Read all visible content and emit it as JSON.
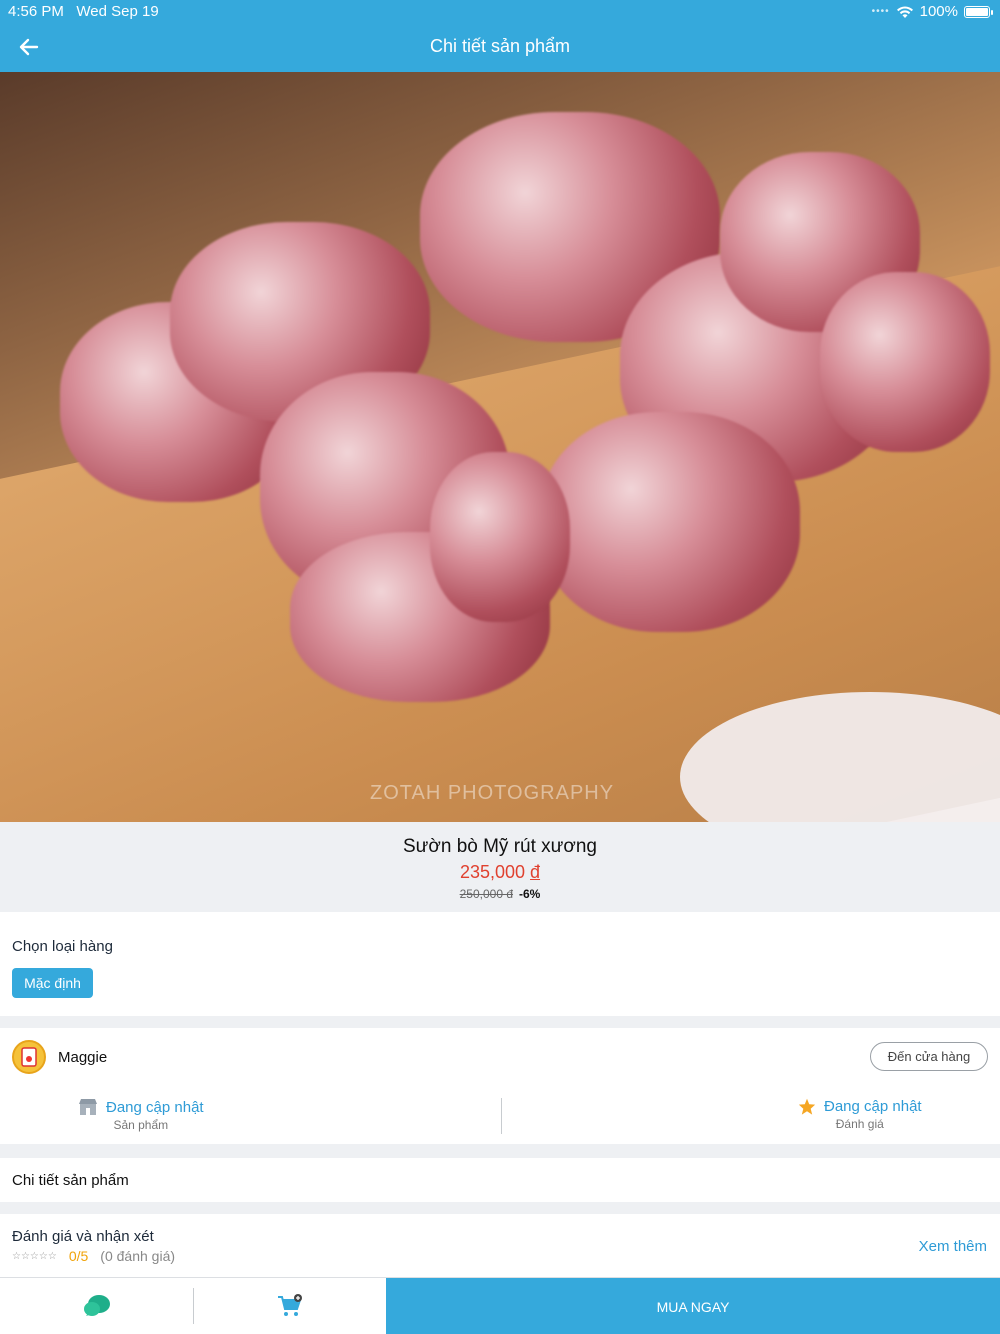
{
  "status_bar": {
    "time": "4:56 PM",
    "date": "Wed Sep 19",
    "battery": "100%"
  },
  "header": {
    "title": "Chi tiết sản phẩm",
    "back_icon": "arrow-left-icon"
  },
  "hero": {
    "watermark": "ZOTAH PHOTOGRAPHY"
  },
  "product": {
    "name": "Sườn bò Mỹ rút xương",
    "price": "235,000",
    "currency": "đ",
    "old_price": "250,000 đ",
    "discount": "-6%"
  },
  "variant": {
    "label": "Chọn loại hàng",
    "selected": "Mặc định"
  },
  "shop": {
    "name": "Maggie",
    "store_button": "Đến cửa hàng",
    "products_value": "Đang cập nhật",
    "products_caption": "Sản phẩm",
    "rating_value": "Đang cập nhật",
    "rating_caption": "Đánh giá"
  },
  "detail": {
    "label": "Chi tiết sản phẩm"
  },
  "review": {
    "label": "Đánh giá và nhận xét",
    "score": "0/5",
    "count": "(0 đánh giá)",
    "more": "Xem thêm"
  },
  "bottom": {
    "buy_label": "MUA NGAY"
  },
  "colors": {
    "primary": "#35a9dc",
    "price": "#e0412f",
    "link": "#2e9bd6",
    "rating": "#f0a30a"
  }
}
